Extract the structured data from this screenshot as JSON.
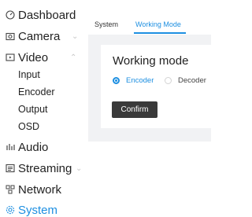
{
  "sidebar": {
    "items": [
      {
        "label": "Dashboard",
        "icon": "dashboard-icon"
      },
      {
        "label": "Camera",
        "icon": "camera-icon"
      },
      {
        "label": "Video",
        "icon": "video-icon",
        "subitems": [
          "Input",
          "Encoder",
          "Output",
          "OSD"
        ]
      },
      {
        "label": "Audio",
        "icon": "audio-icon"
      },
      {
        "label": "Streaming",
        "icon": "streaming-icon"
      },
      {
        "label": "Network",
        "icon": "network-icon"
      },
      {
        "label": "System",
        "icon": "system-icon",
        "active": true
      }
    ]
  },
  "tabs": [
    {
      "label": "System"
    },
    {
      "label": "Working Mode",
      "active": true
    }
  ],
  "card": {
    "title": "Working mode",
    "options": [
      {
        "label": "Encoder",
        "checked": true
      },
      {
        "label": "Decoder",
        "checked": false
      }
    ],
    "confirm_label": "Confirm"
  },
  "colors": {
    "accent": "#1d8fe1",
    "button": "#3a3a3a",
    "content_bg": "#f1f2f4"
  }
}
